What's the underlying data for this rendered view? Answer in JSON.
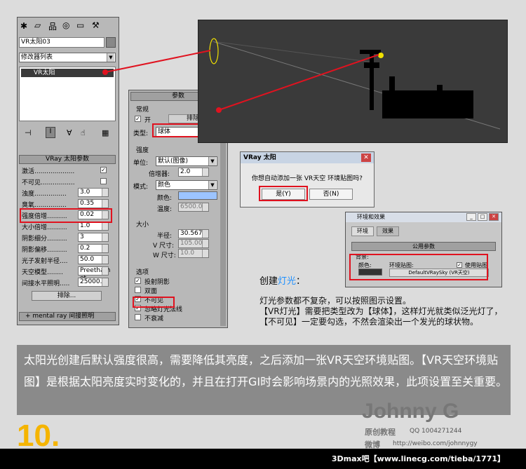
{
  "modifier_panel": {
    "object_name": "VR太阳03",
    "modifier_list": "修改器列表",
    "stack_item": "VR太阳",
    "rollout_title": "VRay 太阳参数",
    "params": [
      {
        "label": "激活...........................",
        "value": "checked"
      },
      {
        "label": "不可见...........................",
        "value": "unchecked"
      },
      {
        "label": "浊度................",
        "value": "3.0"
      },
      {
        "label": "臭氧................",
        "value": "0.35"
      },
      {
        "label": "强度倍增..........",
        "value": "0.02"
      },
      {
        "label": "大小倍增..........",
        "value": "1.0"
      },
      {
        "label": "阴影细分..........",
        "value": "3"
      },
      {
        "label": "阴影偏移..........",
        "value": "0.2"
      },
      {
        "label": "光子发射半径....",
        "value": "50.0"
      },
      {
        "label": "天空模型........",
        "value": "Preetham et"
      },
      {
        "label": "间接水平照明.....",
        "value": "25000."
      }
    ],
    "exclude_button": "排除...",
    "mr_rollout": "mental ray 间接照明"
  },
  "light_panel": {
    "header": "参数",
    "group_general": "常规",
    "on_label": "开",
    "exclude_label": "排除",
    "type_label": "类型:",
    "type_value": "球体",
    "group_intensity": "强度",
    "unit_label": "单位:",
    "unit_value": "默认(图像)",
    "multiplier_label": "倍增器:",
    "multiplier_value": "2.0",
    "mode_label": "模式:",
    "mode_value": "颜色",
    "color_label": "颜色:",
    "temp_label": "温度:",
    "temp_value": "6500.0",
    "group_size": "大小",
    "half_length_label": "半径:",
    "half_length_value": "30.567",
    "v_size_label": "V 尺寸:",
    "v_size_value": "105.006",
    "w_size_label": "W 尺寸:",
    "w_size_value": "10.0",
    "group_options": "选项",
    "options": [
      "投射阴影",
      "双面",
      "不可见",
      "忽略灯光法线",
      "不衰减"
    ]
  },
  "dialog_vray": {
    "title": "VRay 太阳",
    "message": "你想自动添加一张 VR天空 环境贴图吗?",
    "yes_button": "是(Y)",
    "no_button": "否(N)"
  },
  "dialog_env": {
    "title": "环境和效果",
    "tab1": "环境",
    "tab2": "效果",
    "section": "公用参数",
    "bg_label": "背景:",
    "color_label": "颜色:",
    "map_label": "环境贴图:",
    "use_map_label": "使用贴图",
    "map_button": "DefaultVRaySky (VR天空)"
  },
  "text_block": {
    "create_prefix": "创建",
    "create_highlight": "灯光",
    "create_suffix": "：",
    "body": "灯光参数都不复杂，可以按照图示设置。\n【VR灯光】需要把类型改为【球体】，这样灯光就类似泛光灯了，【不可见】一定要勾选，不然会渲染出一个发光的球状物。"
  },
  "caption": "太阳光创建后默认强度很高，需要降低其亮度，之后添加一张VR天空环境贴图。【VR天空环境贴图】是根据太阳亮度实时变化的，并且在打开GI时会影响场景内的光照效果，此项设置至关重要。",
  "step_number": "10.",
  "brand": {
    "name": "Johnny G",
    "sub": "原创教程",
    "qq": "QQ  1004271244",
    "weibo_label": "微博",
    "weibo_url": "http://weibo.com/johnnygy",
    "footer": "3Dmax吧【www.linecg.com/tieba/1771】"
  },
  "colors": {
    "accent_red": "#e0121f",
    "highlight_blue": "#1e90ff",
    "step_yellow": "#f5b400"
  }
}
